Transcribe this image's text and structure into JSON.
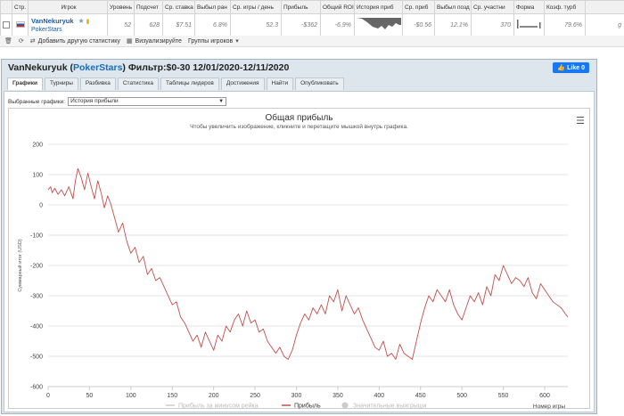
{
  "table": {
    "headers": [
      "Стр.",
      "Игрок",
      "Уровень",
      "Подсчет",
      "Ср. ставка",
      "Выбыл ран",
      "Ср. игры / день",
      "Прибыль",
      "Общий ROI",
      "История приб",
      "Ср. приб",
      "Выбыл позд",
      "Ср. участни",
      "Форма",
      "Коэф. турб",
      ""
    ],
    "row": {
      "player": "VanNekuryuk",
      "network": "PokerStars",
      "level": "52",
      "count": "628",
      "avg_stake": "$7.51",
      "early_out": "6.8%",
      "games_per_day": "52.3",
      "profit": "-$362",
      "roi": "-6.9%",
      "avg_profit": "-$0.56",
      "late_out": "12.1%",
      "avg_entrants": "370",
      "turbo": "79.6%",
      "last": "g"
    }
  },
  "toolbar": {
    "add_stats": "Добавить другую статистику",
    "visualize": "Визуализируйте",
    "groups": "Группы игроков"
  },
  "window": {
    "player": "VanNekuryuk",
    "network": "PokerStars",
    "filter": " Фильтр:$0-30 12/01/2020-12/11/2020",
    "like": "Like 0",
    "tabs": [
      "Графики",
      "Турниры",
      "Разбивка",
      "Статистика",
      "Таблицы лидеров",
      "Достижения",
      "Найти",
      "Опубликовать"
    ],
    "selected_label": "Выбранные графики:",
    "selected_value": "История прибыли"
  },
  "chart_data": {
    "type": "line",
    "title": "Общая прибыль",
    "subtitle": "Чтобы увеличить изображение, кликните и перетащите мышкой внутрь графика.",
    "ylabel": "Суммарный итог (USD)",
    "xlabel": "Номер игры",
    "xlim": [
      0,
      628
    ],
    "ylim": [
      -600,
      200
    ],
    "xticks": [
      0,
      50,
      100,
      150,
      200,
      250,
      300,
      350,
      400,
      450,
      500,
      550,
      600
    ],
    "yticks": [
      200,
      100,
      0,
      -100,
      -200,
      -300,
      -400,
      -500,
      -600
    ],
    "legend": [
      "Прибыль за минусом рейка",
      "Прибыль",
      "Значительные выигрыши"
    ],
    "legend_position": "bottom",
    "color": "#c0504d",
    "series": [
      {
        "name": "Прибыль",
        "x": [
          0,
          3,
          5,
          8,
          12,
          16,
          20,
          25,
          30,
          33,
          36,
          40,
          44,
          48,
          52,
          56,
          60,
          64,
          68,
          72,
          76,
          80,
          85,
          90,
          95,
          100,
          105,
          110,
          115,
          120,
          125,
          130,
          135,
          140,
          145,
          150,
          155,
          160,
          165,
          170,
          175,
          180,
          185,
          190,
          195,
          200,
          205,
          210,
          215,
          220,
          225,
          230,
          235,
          240,
          245,
          250,
          255,
          260,
          265,
          270,
          275,
          280,
          285,
          290,
          295,
          300,
          305,
          310,
          315,
          320,
          325,
          330,
          335,
          340,
          345,
          350,
          355,
          360,
          365,
          370,
          375,
          380,
          385,
          390,
          395,
          400,
          405,
          410,
          415,
          420,
          425,
          430,
          435,
          440,
          445,
          450,
          455,
          460,
          465,
          470,
          475,
          480,
          485,
          490,
          495,
          500,
          505,
          510,
          515,
          520,
          525,
          530,
          535,
          540,
          545,
          550,
          555,
          560,
          565,
          570,
          575,
          580,
          585,
          590,
          595,
          600,
          605,
          610,
          615,
          620,
          625,
          628
        ],
        "y": [
          50,
          60,
          40,
          55,
          35,
          50,
          30,
          60,
          20,
          80,
          120,
          90,
          50,
          105,
          60,
          20,
          80,
          40,
          -10,
          30,
          0,
          -40,
          -90,
          -60,
          -120,
          -160,
          -140,
          -190,
          -170,
          -230,
          -210,
          -250,
          -240,
          -270,
          -300,
          -330,
          -320,
          -370,
          -390,
          -420,
          -450,
          -430,
          -470,
          -420,
          -450,
          -480,
          -430,
          -450,
          -400,
          -420,
          -380,
          -360,
          -400,
          -350,
          -390,
          -380,
          -420,
          -410,
          -450,
          -470,
          -490,
          -470,
          -500,
          -510,
          -480,
          -430,
          -390,
          -360,
          -380,
          -340,
          -360,
          -330,
          -360,
          -300,
          -320,
          -280,
          -350,
          -300,
          -330,
          -360,
          -340,
          -380,
          -410,
          -440,
          -470,
          -480,
          -450,
          -500,
          -490,
          -510,
          -460,
          -490,
          -500,
          -510,
          -450,
          -390,
          -340,
          -300,
          -320,
          -280,
          -300,
          -320,
          -280,
          -330,
          -360,
          -380,
          -340,
          -300,
          -320,
          -290,
          -330,
          -270,
          -300,
          -230,
          -250,
          -200,
          -230,
          -260,
          -240,
          -250,
          -270,
          -240,
          -290,
          -310,
          -260,
          -280,
          -300,
          -320,
          -330,
          -340,
          -360,
          -370
        ]
      }
    ]
  }
}
